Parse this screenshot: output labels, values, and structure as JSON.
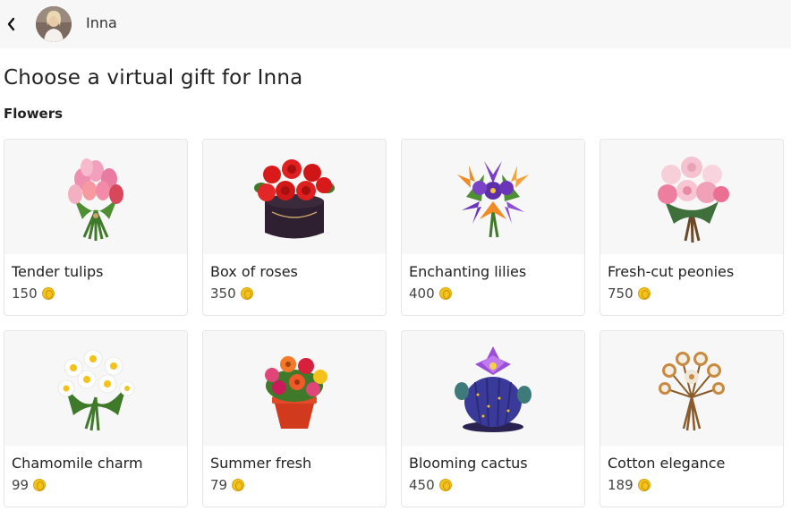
{
  "header": {
    "back_icon": "chevron-left-icon",
    "username": "Inna"
  },
  "title": "Choose a virtual gift for Inna",
  "section": "Flowers",
  "currency_icon": "coin-icon",
  "gifts": [
    {
      "name": "Tender tulips",
      "price": "150",
      "icon": "tulips-bouquet-icon"
    },
    {
      "name": "Box of roses",
      "price": "350",
      "icon": "roses-box-icon"
    },
    {
      "name": "Enchanting lilies",
      "price": "400",
      "icon": "lilies-bouquet-icon"
    },
    {
      "name": "Fresh-cut peonies",
      "price": "750",
      "icon": "peonies-bouquet-icon"
    },
    {
      "name": "Chamomile charm",
      "price": "99",
      "icon": "chamomile-bouquet-icon"
    },
    {
      "name": "Summer fresh",
      "price": "79",
      "icon": "flower-pot-icon"
    },
    {
      "name": "Blooming cactus",
      "price": "450",
      "icon": "cactus-icon"
    },
    {
      "name": "Cotton elegance",
      "price": "189",
      "icon": "cotton-bouquet-icon"
    }
  ],
  "colors": {
    "header_bg": "#f7f7f7",
    "image_bg": "#f7f7f7",
    "coin": "#f3c21b"
  }
}
